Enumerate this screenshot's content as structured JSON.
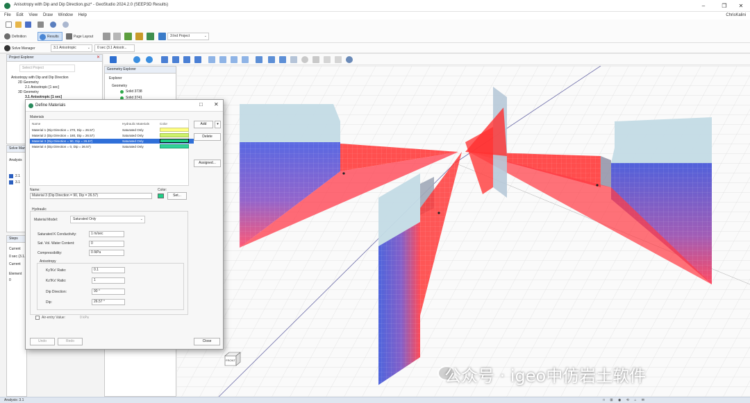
{
  "window": {
    "title": "Anisotropy with Dip and Dip Direction.gsz* - GeoStudio 2024.2.0 (SEEP3D Results)",
    "user": "ChrisKalini",
    "controls": [
      "–",
      "❐",
      "✕"
    ]
  },
  "menu": [
    "File",
    "Edit",
    "View",
    "Draw",
    "Window",
    "Help"
  ],
  "toolbar": {
    "definition_label": "Definition",
    "results_label": "Results",
    "page_layout_label": "Page Layout",
    "project_combo": "3:Ind Project",
    "solve_manager_label": "Solve Manager",
    "analysis_combo": "3.1 Anisotropic",
    "time_combo": "0 sec (3.1 Anisotr..."
  },
  "project_explorer": {
    "title": "Project Explorer",
    "select_project": "Select Project",
    "items": [
      "Anisotropy with Dip and Dip Direction",
      "2D Geometry",
      "2.1 Anisotropic [1 sec]",
      "3D Geometry",
      "3.1 Anisotropic [1 sec]"
    ]
  },
  "geometry_explorer": {
    "title": "Geometry Explorer",
    "explorer_label": "Explorer",
    "geometry_label": "Geometry",
    "items": [
      "Solid 3738",
      "Solid 3741"
    ]
  },
  "side_panels": {
    "solve_manager": "Solve Manager",
    "analysis": "Analysis",
    "item1": "2.1",
    "item2": "3.1",
    "steps": "Steps",
    "current": "Current",
    "time": "0 sec (3.1...",
    "current_btn": "Current",
    "element": "Element",
    "zero": "0"
  },
  "dialog": {
    "title": "Define Materials",
    "materials_group": "Materials",
    "columns": [
      "Name",
      "Hydraulic Materials",
      "Color"
    ],
    "rows": [
      {
        "name": "Material 1 (Dip Direction = 270, Dip = 26.57)",
        "hydraulic": "Saturated Only",
        "color": "#ffff80"
      },
      {
        "name": "Material 2 (Dip Direction = 180, Dip = 26.57)",
        "hydraulic": "Saturated Only",
        "color": "#cdf36a"
      },
      {
        "name": "Material 3 (Dip Direction = 90, Dip = 26.57)",
        "hydraulic": "Saturated Only",
        "color": "#1fcf86"
      },
      {
        "name": "Material 4 (Dip Direction = 0, Dip = 26.57)",
        "hydraulic": "Saturated Only",
        "color": "#2fd39a"
      }
    ],
    "buttons": {
      "add": "Add",
      "delete": "Delete",
      "assigned": "Assigned...",
      "close": "Close",
      "undo": "Undo",
      "redo": "Redo",
      "set": "Set..."
    },
    "name_label": "Name:",
    "name_value": "Material 3 (Dip Direction = 90, Dip = 26.57)",
    "color_label": "Color:",
    "hydraulic_group": "Hydraulic",
    "material_model_label": "Material Model:",
    "material_model_value": "Saturated Only",
    "sat_k_label": "Saturated K Conductivity:",
    "sat_k_value": "1 m/sec",
    "sat_vwc_label": "Sat. Vol. Water Content:",
    "sat_vwc_value": "0",
    "compress_label": "Compressibility:",
    "compress_value": "0 /kPa",
    "anisotropy_group": "Anisotropy",
    "ratio1_label": "Ky'/Kx' Ratio:",
    "ratio1_value": "0.1",
    "ratio2_label": "Kz'/Kx' Ratio:",
    "ratio2_value": "1",
    "dipdir_label": "Dip Direction:",
    "dipdir_value": "90 °",
    "dip_label": "Dip:",
    "dip_value": "26.57 °",
    "airentry_label": "Air-entry Value:",
    "airentry_value": "0 kPa"
  },
  "viewport": {
    "navcube_label": "FRONT"
  },
  "status": {
    "left": "Analysis: 3.1",
    "right": "□ ⊞ ◉ ⟲ ⌂ ✉"
  },
  "watermark": "公众号 · igeo中仿岩土软件",
  "colors": {
    "panel_header": "#e8eef7",
    "selected_row": "#2f6fd8",
    "red_material": "#ff3030",
    "blue_material": "#3a4fd8",
    "pale_wall": "#c6dde6"
  }
}
